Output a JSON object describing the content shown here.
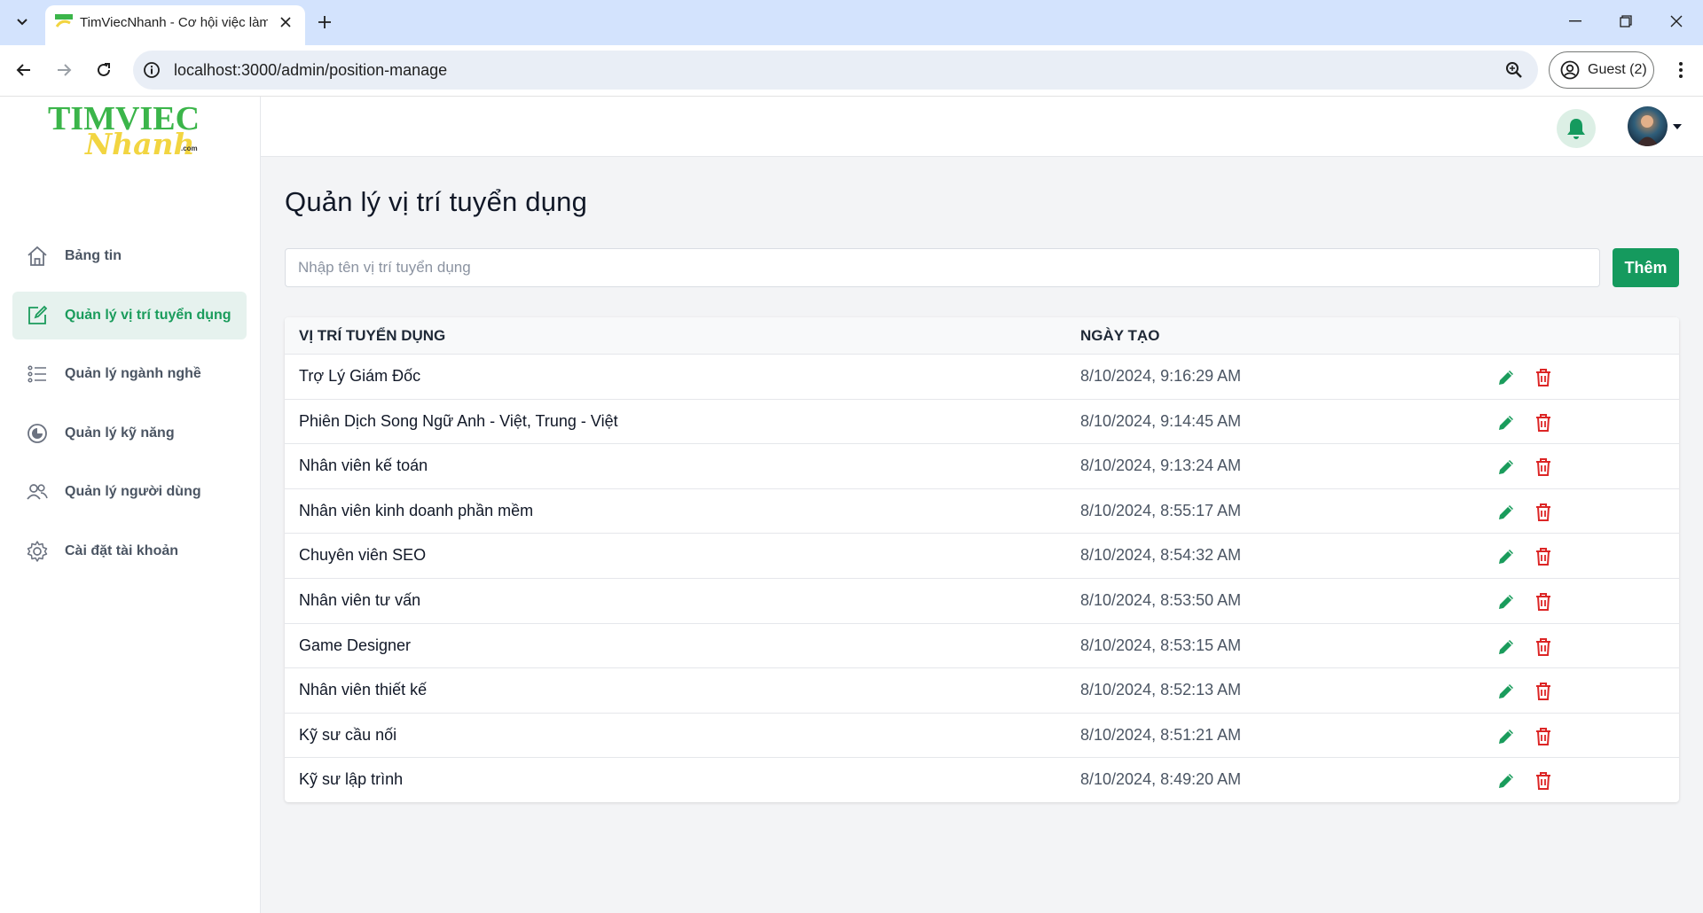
{
  "browser": {
    "tab_title": "TimViecNhanh - Cơ hội việc làm",
    "url": "localhost:3000/admin/position-manage",
    "profile_label": "Guest (2)"
  },
  "sidebar": {
    "logo_text": "TIMVIEC",
    "logo_script": "Nhanh",
    "logo_suffix": ".com",
    "items": [
      {
        "label": "Bảng tin",
        "icon": "home-icon",
        "active": false
      },
      {
        "label": "Quản lý vị trí tuyển dụng",
        "icon": "edit-square-icon",
        "active": true
      },
      {
        "label": "Quản lý ngành nghề",
        "icon": "list-icon",
        "active": false
      },
      {
        "label": "Quản lý kỹ năng",
        "icon": "pie-chart-icon",
        "active": false
      },
      {
        "label": "Quản lý người dùng",
        "icon": "users-icon",
        "active": false
      },
      {
        "label": "Cài đặt tài khoản",
        "icon": "settings-icon",
        "active": false
      }
    ]
  },
  "main": {
    "title": "Quản lý vị trí tuyển dụng",
    "search_placeholder": "Nhập tên vị trí tuyển dụng",
    "add_button": "Thêm",
    "table": {
      "headers": [
        "VỊ TRÍ TUYỂN DỤNG",
        "NGÀY TẠO"
      ],
      "rows": [
        {
          "name": "Trợ Lý Giám Đốc",
          "created": "8/10/2024, 9:16:29 AM"
        },
        {
          "name": "Phiên Dịch Song Ngữ Anh - Việt, Trung - Việt",
          "created": "8/10/2024, 9:14:45 AM"
        },
        {
          "name": "Nhân viên kế toán",
          "created": "8/10/2024, 9:13:24 AM"
        },
        {
          "name": "Nhân viên kinh doanh phần mềm",
          "created": "8/10/2024, 8:55:17 AM"
        },
        {
          "name": "Chuyên viên SEO",
          "created": "8/10/2024, 8:54:32 AM"
        },
        {
          "name": "Nhân viên tư vấn",
          "created": "8/10/2024, 8:53:50 AM"
        },
        {
          "name": "Game Designer",
          "created": "8/10/2024, 8:53:15 AM"
        },
        {
          "name": "Nhân viên thiết kế",
          "created": "8/10/2024, 8:52:13 AM"
        },
        {
          "name": "Kỹ sư cầu nối",
          "created": "8/10/2024, 8:51:21 AM"
        },
        {
          "name": "Kỹ sư lập trình",
          "created": "8/10/2024, 8:49:20 AM"
        }
      ]
    }
  },
  "colors": {
    "accent": "#159a5e",
    "edit": "#1a9c5c",
    "delete": "#dc2626",
    "logo_green": "#3bb54a",
    "logo_yellow": "#f2d541"
  }
}
